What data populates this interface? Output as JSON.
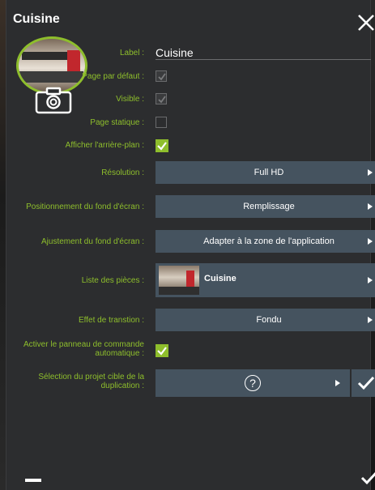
{
  "dialog": {
    "title": "Cuisine"
  },
  "icons": {
    "close": "close-icon",
    "camera": "camera-icon",
    "help": "question-circle-icon",
    "minus": "minus-icon",
    "check": "check-icon"
  },
  "colors": {
    "accent": "#8ebe2c",
    "panel": "#2c2d2f",
    "select_bg": "#45535f"
  },
  "form": {
    "label": {
      "text": "Label :",
      "value": "Cuisine"
    },
    "default_page": {
      "text": "Page par défaut :",
      "checked": true,
      "disabled": true
    },
    "visible": {
      "text": "Visible :",
      "checked": true,
      "disabled": true
    },
    "static_page": {
      "text": "Page statique :",
      "checked": false
    },
    "show_background": {
      "text": "Afficher l'arrière-plan :",
      "checked": true
    },
    "resolution": {
      "text": "Résolution :",
      "value": "Full HD"
    },
    "wallpaper_position": {
      "text": "Positionnement du fond d'écran :",
      "value": "Remplissage"
    },
    "wallpaper_fit": {
      "text": "Ajustement du fond d'écran :",
      "value": "Adapter à la zone de l'application"
    },
    "room_list": {
      "text": "Liste des pièces :",
      "value": "Cuisine"
    },
    "transition": {
      "text": "Effet de transtion :",
      "value": "Fondu"
    },
    "auto_panel": {
      "text": "Activer le panneau de commande automatique :",
      "checked": true
    },
    "target_project": {
      "text": "Sélection du projet cible de la duplication :",
      "value": "?"
    }
  }
}
